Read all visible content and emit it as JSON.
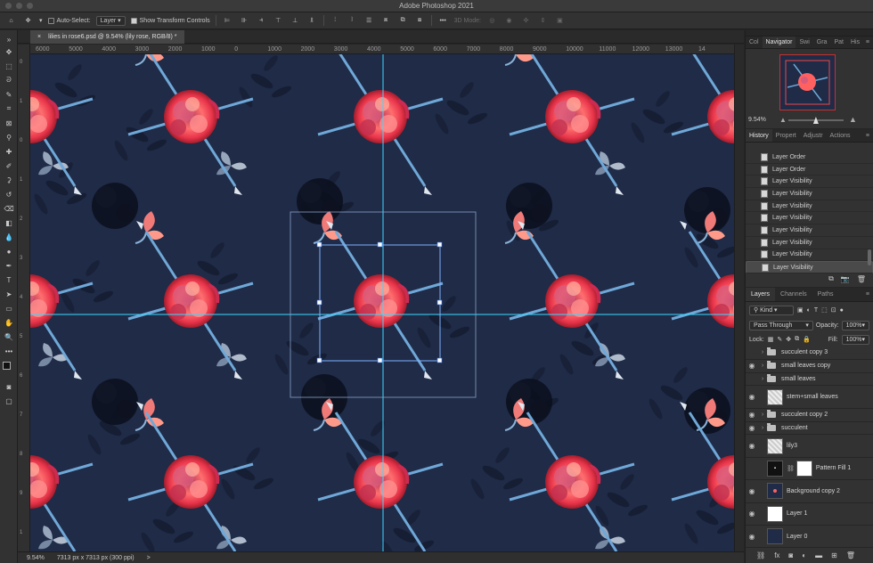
{
  "app": {
    "title": "Adobe Photoshop 2021"
  },
  "options_bar": {
    "auto_select_label": "Auto-Select:",
    "auto_select_target": "Layer",
    "show_transform_label": "Show Transform Controls",
    "three_d_label": "3D Mode:"
  },
  "document": {
    "tab_title": "lilies in rose6.psd @ 9.54% (lily rose, RGB/8) *",
    "tab_close": "×"
  },
  "ruler_top": [
    "6000",
    "5000",
    "4000",
    "3000",
    "2000",
    "1000",
    "0",
    "1000",
    "2000",
    "3000",
    "4000",
    "5000",
    "6000",
    "7000",
    "8000",
    "9000",
    "10000",
    "11000",
    "12000",
    "13000",
    "14"
  ],
  "ruler_left": [
    "0",
    "1",
    "0",
    "1",
    "2",
    "3",
    "4",
    "5",
    "6",
    "7",
    "8",
    "9",
    "1"
  ],
  "status": {
    "zoom": "9.54%",
    "doc_info": "7313 px x 7313 px (300 ppi)",
    "arrow": ">"
  },
  "navigator": {
    "tabs": [
      "Col",
      "Navigator",
      "Swi",
      "Gra",
      "Pat",
      "His"
    ],
    "active_tab": "Navigator",
    "zoom": "9.54%",
    "zoom_fraction": 0.45
  },
  "history": {
    "tabs": [
      "History",
      "Propert",
      "Adjustr",
      "Actions"
    ],
    "items": [
      "Layer Order",
      "Layer Order",
      "Layer Visibility",
      "Layer Visibility",
      "Layer Visibility",
      "Layer Visibility",
      "Layer Visibility",
      "Layer Visibility",
      "Layer Visibility",
      "Layer Visibility"
    ]
  },
  "layers": {
    "tabs": [
      "Layers",
      "Channels",
      "Paths"
    ],
    "filter_kind": "Kind",
    "blend_mode": "Pass Through",
    "opacity_label": "Opacity:",
    "opacity_value": "100%",
    "lock_label": "Lock:",
    "fill_label": "Fill:",
    "fill_value": "100%",
    "items": [
      {
        "name": "succulent copy 3",
        "type": "group",
        "visible": false
      },
      {
        "name": "small leaves copy",
        "type": "group",
        "visible": true
      },
      {
        "name": "small leaves",
        "type": "group",
        "visible": false
      },
      {
        "name": "stem+small leaves",
        "type": "smart",
        "visible": true
      },
      {
        "name": "succulent copy 2",
        "type": "group",
        "visible": true
      },
      {
        "name": "succulent",
        "type": "group",
        "visible": true
      },
      {
        "name": "lily3",
        "type": "smart",
        "visible": true
      },
      {
        "name": "Pattern Fill 1",
        "type": "fill",
        "visible": false
      },
      {
        "name": "Background copy 2",
        "type": "pixel",
        "visible": true
      },
      {
        "name": "Layer 1",
        "type": "white",
        "visible": true
      },
      {
        "name": "Layer 0",
        "type": "navy",
        "visible": true
      }
    ]
  },
  "colors": {
    "canvas_bg": "#1f2b47",
    "guide": "#3ed8ff",
    "rose": "#ff5a5a",
    "accent": "#e84a4a"
  }
}
